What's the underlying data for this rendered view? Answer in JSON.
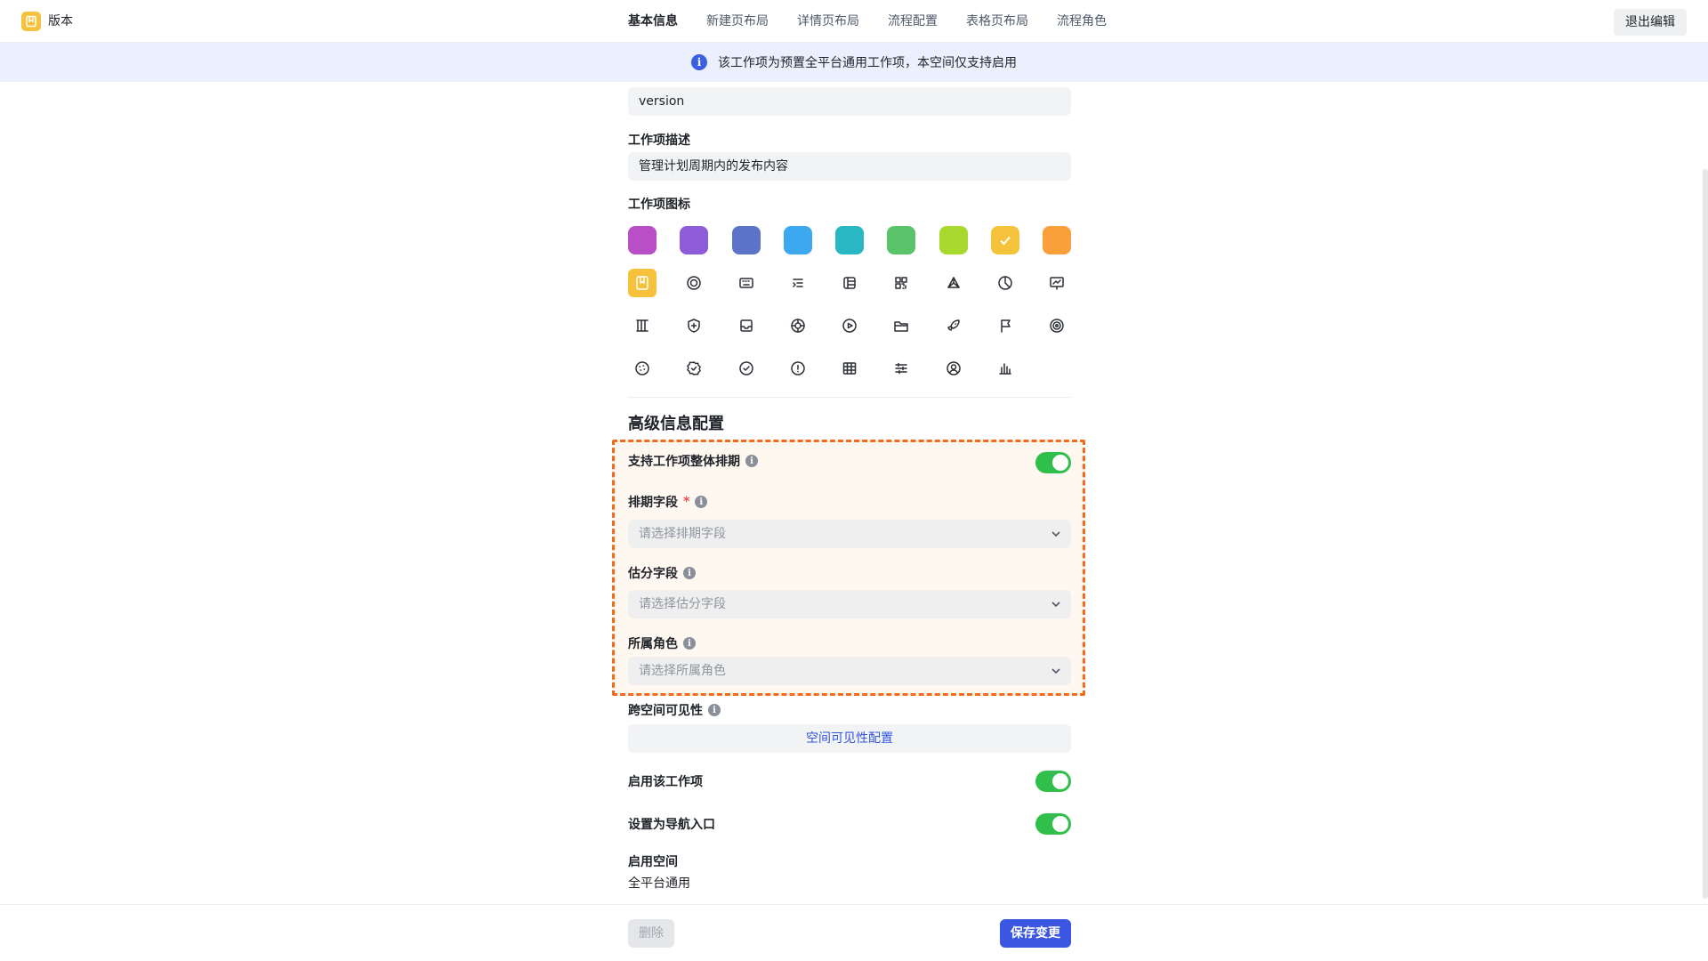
{
  "header": {
    "app_title": "版本",
    "tabs": [
      {
        "label": "基本信息",
        "active": true
      },
      {
        "label": "新建页布局",
        "active": false
      },
      {
        "label": "详情页布局",
        "active": false
      },
      {
        "label": "流程配置",
        "active": false
      },
      {
        "label": "表格页布局",
        "active": false
      },
      {
        "label": "流程角色",
        "active": false
      }
    ],
    "exit_label": "退出编辑"
  },
  "notice": {
    "text": "该工作项为预置全平台通用工作项，本空间仅支持启用"
  },
  "basic": {
    "key_value": "version",
    "desc_label": "工作项描述",
    "desc_value": "管理计划周期内的发布内容",
    "icon_label": "工作项图标",
    "colors": [
      "#b84fc6",
      "#8e5cd9",
      "#5b74c9",
      "#3ba8f0",
      "#28b7c3",
      "#5bc46a",
      "#a8d92f",
      "#f5c23b",
      "#f9a03b"
    ],
    "selected_color_index": 7,
    "icons": [
      "bookmark-icon",
      "smile-icon",
      "keyboard-icon",
      "indent-list-icon",
      "server-list-icon",
      "qr-grid-icon",
      "triangle-nodes-icon",
      "pie-chart-icon",
      "presentation-icon",
      "library-icon",
      "shield-plus-icon",
      "inbox-icon",
      "crosshair-icon",
      "play-circle-icon",
      "folder-icon",
      "rocket-icon",
      "flag-icon",
      "target-icon",
      "cookie-icon",
      "badge-check-icon",
      "check-circle-icon",
      "alert-circle-icon",
      "calendar-grid-icon",
      "sliders-icon",
      "user-circle-icon",
      "bar-chart-icon"
    ],
    "selected_icon_index": 0
  },
  "advanced": {
    "title": "高级信息配置",
    "schedule_label": "支持工作项整体排期",
    "schedule_enabled": true,
    "schedule_field_label": "排期字段",
    "required_mark": "*",
    "schedule_field_placeholder": "请选择排期字段",
    "estimate_label": "估分字段",
    "estimate_placeholder": "请选择估分字段",
    "role_label": "所属角色",
    "role_placeholder": "请选择所属角色",
    "cross_space_label": "跨空间可见性",
    "visibility_button": "空间可见性配置",
    "enable_item_label": "启用该工作项",
    "enable_item_on": true,
    "nav_entry_label": "设置为导航入口",
    "nav_entry_on": true,
    "enabled_space_label": "启用空间",
    "enabled_space_value": "全平台通用"
  },
  "footer": {
    "delete_label": "删除",
    "save_label": "保存变更"
  },
  "info_glyph": "i",
  "accent": "#3b56e0"
}
